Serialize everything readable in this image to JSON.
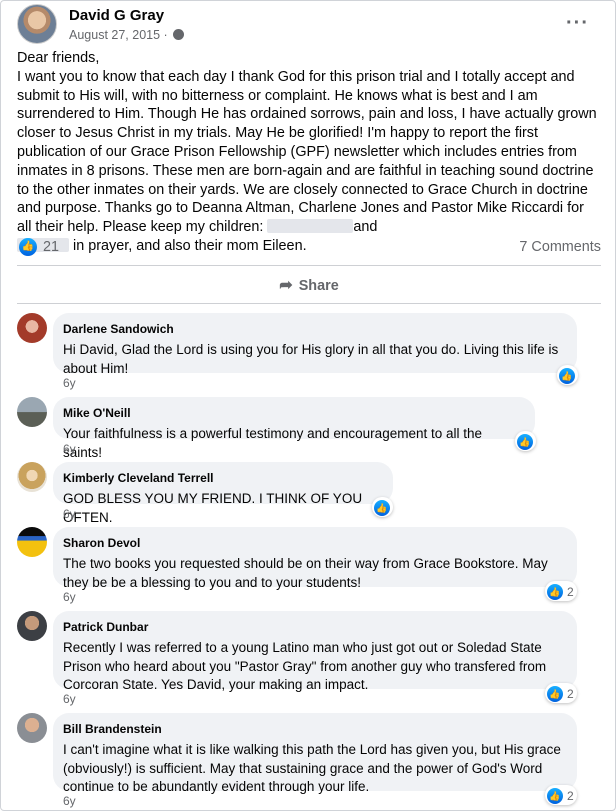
{
  "post": {
    "author": "David G Gray",
    "date": "August 27, 2015 ·",
    "body_before": "Dear friends,\nI want you to know that each day I thank God for this prison trial and I totally accept and submit to His will, with no bitterness or complaint. He knows what is best and I am surrendered to Him. Though He has ordained sorrows, pain and loss, I have actually grown closer to Jesus Christ in my trials. May He be glorified! I'm happy to report the first publication of our Grace Prison Fellowship (GPF) newsletter which includes entries from inmates in 8 prisons. These men are born-again and are faithful in teaching sound doctrine to the other inmates on their yards. We are closely connected to Grace Church in doctrine and purpose. Thanks go to Deanna Altman, Charlene Jones and Pastor Mike Riccardi for all their help. Please keep my children: ",
    "body_mid": "and\n",
    "body_after": " in prayer, and also their mom Eileen.",
    "likes": "21",
    "comments_label": "7 Comments",
    "share_label": "Share"
  },
  "comments": [
    {
      "name": "Darlene Sandowich",
      "text": "Hi David, Glad the Lord is using you for His glory in all that you do. Living this life is about Him!",
      "age": "6y",
      "reactions": ""
    },
    {
      "name": "Mike O'Neill",
      "text": "Your faithfulness is a powerful testimony and encouragement to all the saints!",
      "age": "6y",
      "reactions": ""
    },
    {
      "name": "Kimberly Cleveland Terrell",
      "text": "GOD BLESS YOU MY FRIEND. I THINK OF YOU OFTEN.",
      "age": "6y",
      "reactions": ""
    },
    {
      "name": "Sharon Devol",
      "text": "The two books you requested should be on their way from Grace Bookstore. May they be be a blessing to you and to your students!",
      "age": "6y",
      "reactions": "2"
    },
    {
      "name": "Patrick Dunbar",
      "text": "Recently I was referred to a young Latino man who just got out or Soledad State Prison who heard about you \"Pastor Gray\" from another guy who transfered from Corcoran State. Yes David, your making an impact.",
      "age": "6y",
      "reactions": "2"
    },
    {
      "name": "Bill Brandenstein",
      "text": "I can't imagine what it is like walking this path the Lord has given you, but His grace (obviously!) is sufficient. May that sustaining grace and the power of God's Word continue to be abundantly evident through your life.",
      "age": "6y",
      "reactions": "2"
    }
  ],
  "icons": {
    "like": "like-icon",
    "share": "share-icon",
    "more": "more-options-icon",
    "privacy": "globe-icon"
  },
  "colors": {
    "like_blue": "#1877f2",
    "bubble_bg": "#f0f2f5",
    "meta_gray": "#65676b"
  }
}
